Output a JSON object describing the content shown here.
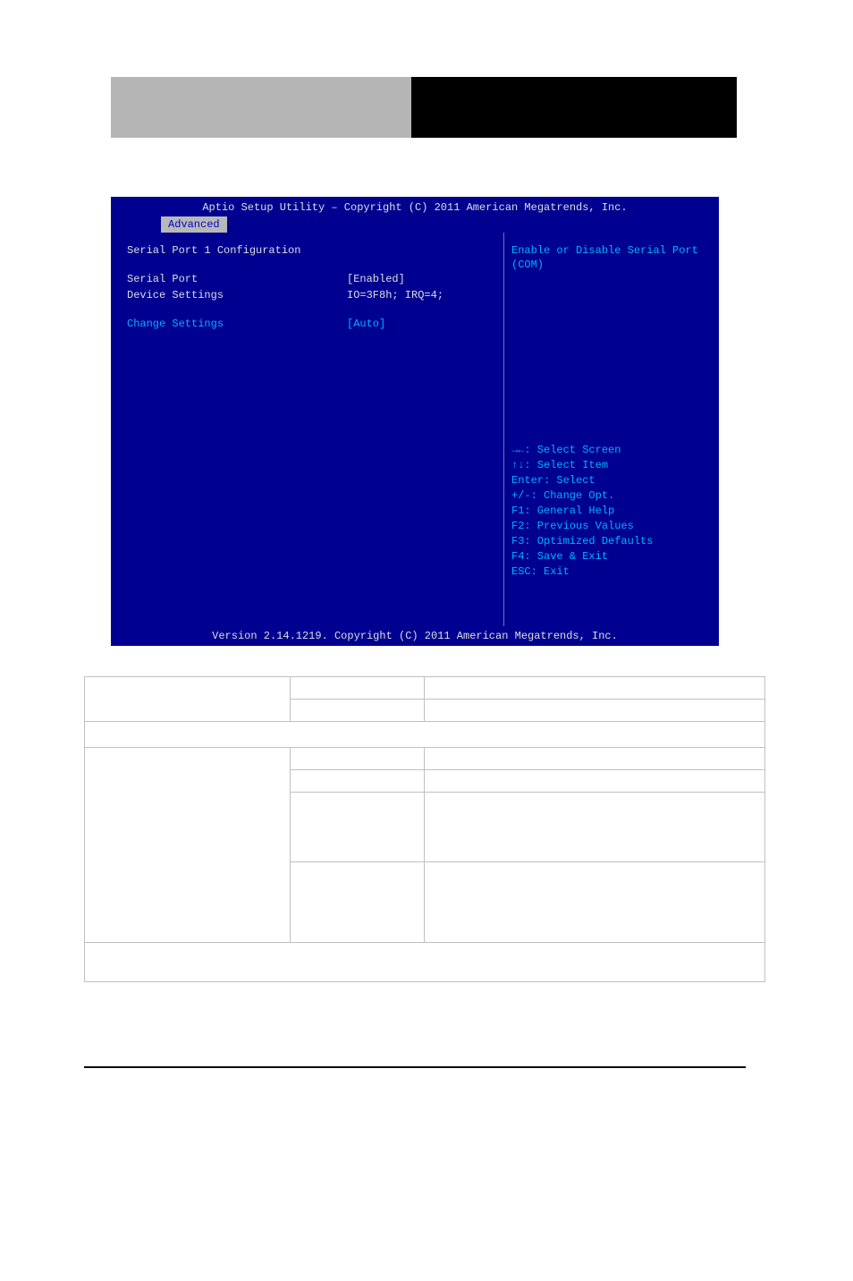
{
  "header": {},
  "bios": {
    "titlebar": "Aptio Setup Utility – Copyright (C) 2011 American Megatrends, Inc.",
    "tab": "Advanced",
    "section_title": "Serial Port 1 Configuration",
    "rows": {
      "serial_port": {
        "label": "Serial Port",
        "value": "[Enabled]"
      },
      "device_settings": {
        "label": "Device Settings",
        "value": "IO=3F8h; IRQ=4;"
      },
      "change_settings": {
        "label": "Change Settings",
        "value": "[Auto]"
      }
    },
    "help_top": "Enable or Disable Serial Port\n(COM)",
    "help_keys": [
      "→←: Select Screen",
      "↑↓: Select Item",
      "Enter: Select",
      "+/-: Change Opt.",
      "F1: General Help",
      "F2: Previous Values",
      "F3: Optimized Defaults",
      "F4: Save & Exit",
      "ESC: Exit"
    ],
    "statusbar": "Version 2.14.1219. Copyright (C) 2011 American Megatrends, Inc."
  },
  "table": {
    "row1": {
      "c1": "",
      "c2": "",
      "c3": ""
    },
    "row2": {
      "c2": "",
      "c3": ""
    },
    "divider": "",
    "row3": {
      "c1": "",
      "c2": "",
      "c3": ""
    },
    "row4": {
      "c2": "",
      "c3": ""
    },
    "row5": {
      "c2": "",
      "c3": ""
    },
    "row6": {
      "c2": "",
      "c3": ""
    },
    "row7": ""
  }
}
